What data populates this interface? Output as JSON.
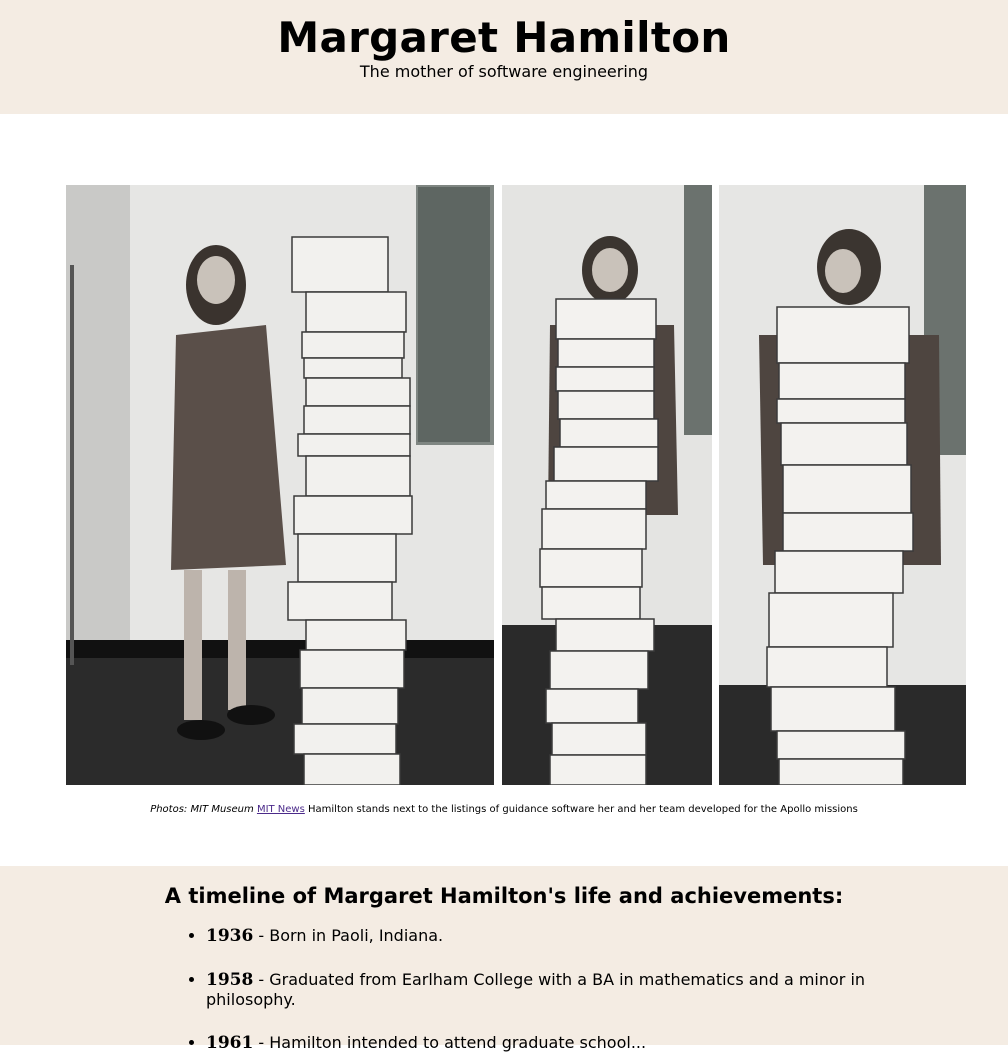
{
  "header": {
    "title": "Margaret Hamilton",
    "subtitle": "The mother of software engineering"
  },
  "photos": {
    "items": [
      {
        "name": "hamilton-standing-beside-listings"
      },
      {
        "name": "hamilton-behind-listings-center"
      },
      {
        "name": "hamilton-behind-listings-right"
      }
    ]
  },
  "caption": {
    "credit": "Photos: MIT Museum",
    "link": "MIT News",
    "text": "Hamilton stands next to the listings of guidance software her and her team developed for the Apollo missions"
  },
  "timeline": {
    "heading": "A timeline of Margaret Hamilton's life and achievements:",
    "items": [
      {
        "year": "1936",
        "text": " - Born in Paoli, Indiana."
      },
      {
        "year": "1958",
        "text": " - Graduated from Earlham College with a BA in mathematics and a minor in philosophy."
      },
      {
        "year": "1961",
        "text": " - Hamilton intended to attend graduate school..."
      }
    ]
  }
}
